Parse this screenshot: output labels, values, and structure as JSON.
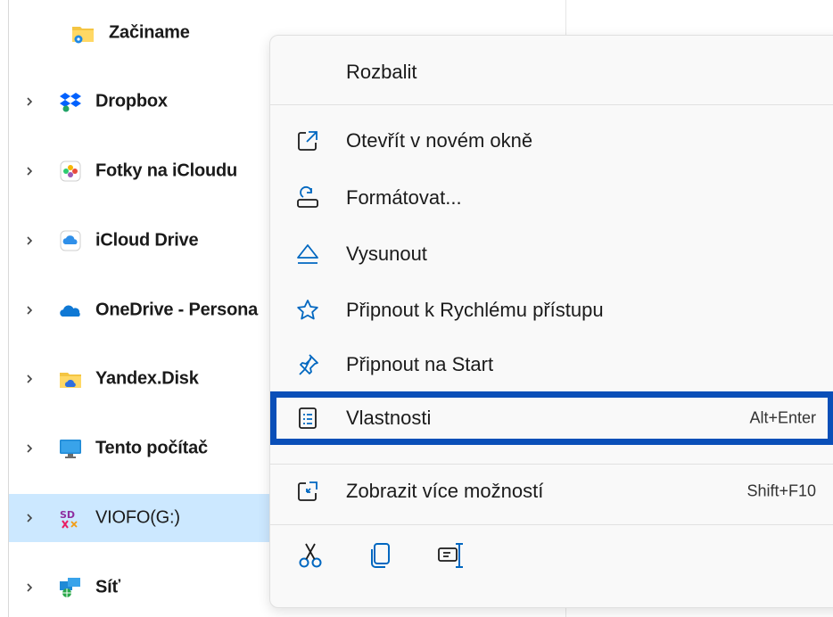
{
  "nav": {
    "items": [
      {
        "label": "Začiname",
        "icon": "folder-star-icon",
        "expandable": false
      },
      {
        "label": "Dropbox",
        "icon": "dropbox-icon",
        "expandable": true
      },
      {
        "label": "Fotky na iCloudu",
        "icon": "icloud-photos-icon",
        "expandable": true
      },
      {
        "label": "iCloud Drive",
        "icon": "icloud-drive-icon",
        "expandable": true
      },
      {
        "label": "OneDrive - Persona",
        "icon": "onedrive-cloud-icon",
        "expandable": true
      },
      {
        "label": "Yandex.Disk",
        "icon": "yandex-disk-folder-icon",
        "expandable": true
      },
      {
        "label": "Tento počítač",
        "icon": "this-pc-monitor-icon",
        "expandable": true
      },
      {
        "label": "VIOFO(G:)",
        "icon": "sd-card-drive-icon",
        "expandable": true,
        "selected": true
      },
      {
        "label": "Síť",
        "icon": "network-icon",
        "expandable": true
      }
    ]
  },
  "menu": {
    "expand_label": "Rozbalit",
    "items": [
      {
        "label": "Otevřít v novém okně",
        "icon": "open-new-window-icon",
        "shortcut": ""
      },
      {
        "label": "Formátovat...",
        "icon": "format-drive-icon",
        "shortcut": ""
      },
      {
        "label": "Vysunout",
        "icon": "eject-icon",
        "shortcut": ""
      },
      {
        "label": "Připnout k Rychlému přístupu",
        "icon": "star-pin-icon",
        "shortcut": ""
      },
      {
        "label": "Připnout na Start",
        "icon": "pin-icon",
        "shortcut": ""
      },
      {
        "label": "Vlastnosti",
        "icon": "properties-icon",
        "shortcut": "Alt+Enter"
      }
    ],
    "more_options": {
      "label": "Zobrazit více možností",
      "icon": "show-more-options-icon",
      "shortcut": "Shift+F10"
    },
    "toolbar": [
      "cut-icon",
      "copy-icon",
      "rename-icon"
    ]
  },
  "colors": {
    "accent": "#0067c0",
    "focus_outline": "#0a4fb8",
    "selected_bg": "#cce8ff"
  }
}
